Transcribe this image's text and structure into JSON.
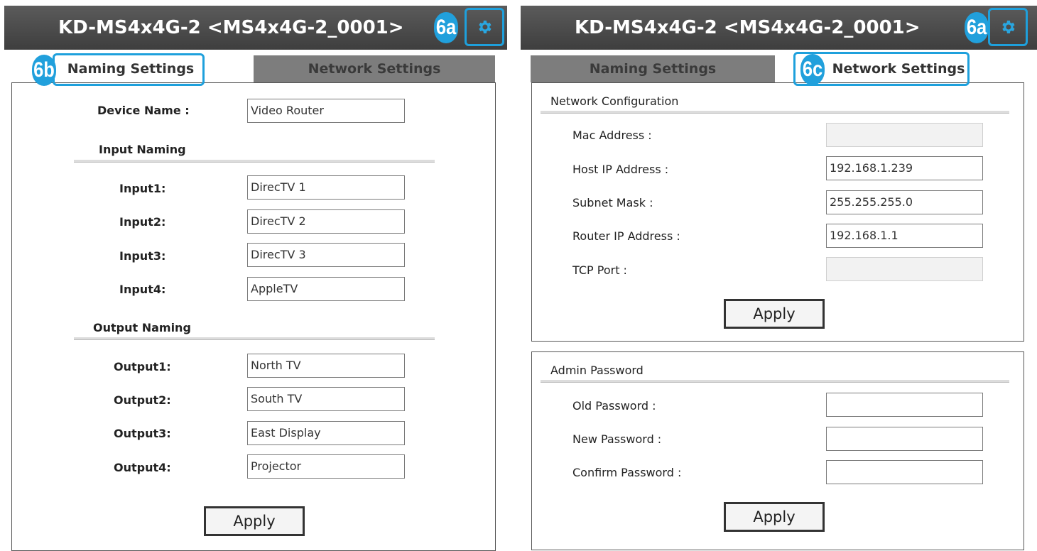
{
  "title": "KD-MS4x4G-2 <MS4x4G-2_0001>",
  "callouts": {
    "gear": "6a",
    "naming_tab": "6b",
    "network_tab": "6c"
  },
  "tabs": {
    "naming": "Naming Settings",
    "network": "Network Settings"
  },
  "naming": {
    "device_name_label": "Device Name :",
    "device_name_value": "Video Router",
    "input_section": "Input Naming",
    "inputs": [
      {
        "label": "Input1:",
        "value": "DirecTV 1"
      },
      {
        "label": "Input2:",
        "value": "DirecTV 2"
      },
      {
        "label": "Input3:",
        "value": "DirecTV 3"
      },
      {
        "label": "Input4:",
        "value": "AppleTV"
      }
    ],
    "output_section": "Output Naming",
    "outputs": [
      {
        "label": "Output1:",
        "value": "North TV"
      },
      {
        "label": "Output2:",
        "value": "South TV"
      },
      {
        "label": "Output3:",
        "value": "East Display"
      },
      {
        "label": "Output4:",
        "value": "Projector"
      }
    ],
    "apply_label": "Apply"
  },
  "network": {
    "section": "Network Configuration",
    "fields": [
      {
        "label": "Mac Address :",
        "value": ""
      },
      {
        "label": "Host IP Address :",
        "value": "192.168.1.239"
      },
      {
        "label": "Subnet Mask :",
        "value": "255.255.255.0"
      },
      {
        "label": "Router IP Address :",
        "value": "192.168.1.1"
      },
      {
        "label": "TCP Port :",
        "value": ""
      }
    ],
    "apply_label": "Apply"
  },
  "admin": {
    "section": "Admin Password",
    "fields": [
      {
        "label": "Old Password :",
        "value": ""
      },
      {
        "label": "New Password :",
        "value": ""
      },
      {
        "label": "Confirm Password :",
        "value": ""
      }
    ],
    "apply_label": "Apply"
  },
  "colors": {
    "accent": "#1ea0dc",
    "titlebar": "#4a4a4a",
    "inactive_tab": "#7d7d7d"
  }
}
